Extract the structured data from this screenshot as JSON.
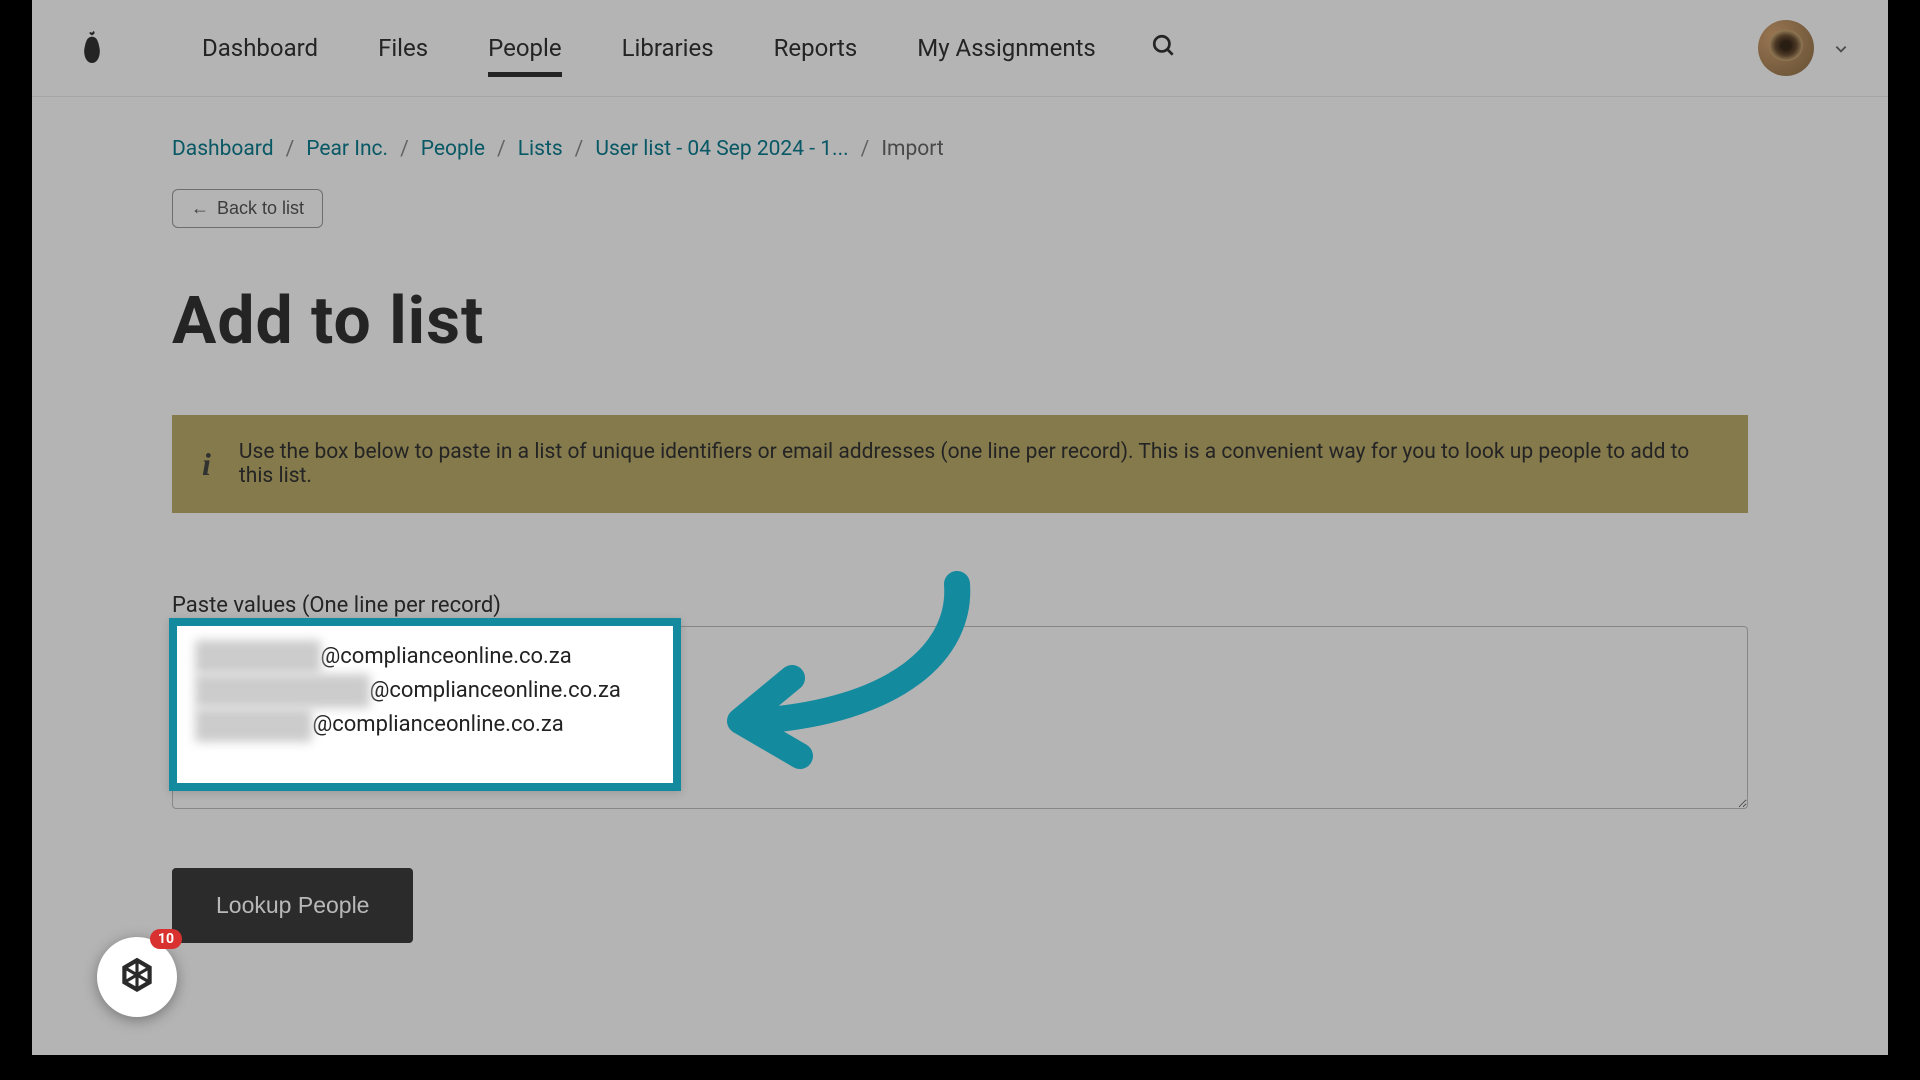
{
  "nav": {
    "items": [
      {
        "label": "Dashboard"
      },
      {
        "label": "Files"
      },
      {
        "label": "People"
      },
      {
        "label": "Libraries"
      },
      {
        "label": "Reports"
      },
      {
        "label": "My Assignments"
      }
    ]
  },
  "breadcrumb": {
    "items": [
      {
        "label": "Dashboard"
      },
      {
        "label": "Pear Inc."
      },
      {
        "label": "People"
      },
      {
        "label": "Lists"
      },
      {
        "label": "User list - 04 Sep 2024 - 1..."
      }
    ],
    "current": "Import"
  },
  "back_button": {
    "arrow": "←",
    "label": "Back to list"
  },
  "page": {
    "title": "Add to list"
  },
  "info": {
    "text": "Use the box below to paste in a list of unique identifiers or email addresses (one line per record). This is a convenient way for you to look up people to add to this list."
  },
  "field": {
    "label": "Paste values (One line per record)"
  },
  "textarea_highlight": {
    "lines": [
      {
        "blur": "xxxxx xxxxxx",
        "visible": "@complianceonline.co.za"
      },
      {
        "blur": "xxxxx xx xxxxxxxx",
        "visible": "@complianceonline.co.za"
      },
      {
        "blur": "xxxxx  Xxxxx",
        "visible": "@complianceonline.co.za"
      }
    ]
  },
  "lookup_button": {
    "label": "Lookup People"
  },
  "chat": {
    "badge": "10"
  },
  "colors": {
    "accent": "#148a9e",
    "info_bg": "#b8a96a",
    "badge": "#d93030"
  }
}
